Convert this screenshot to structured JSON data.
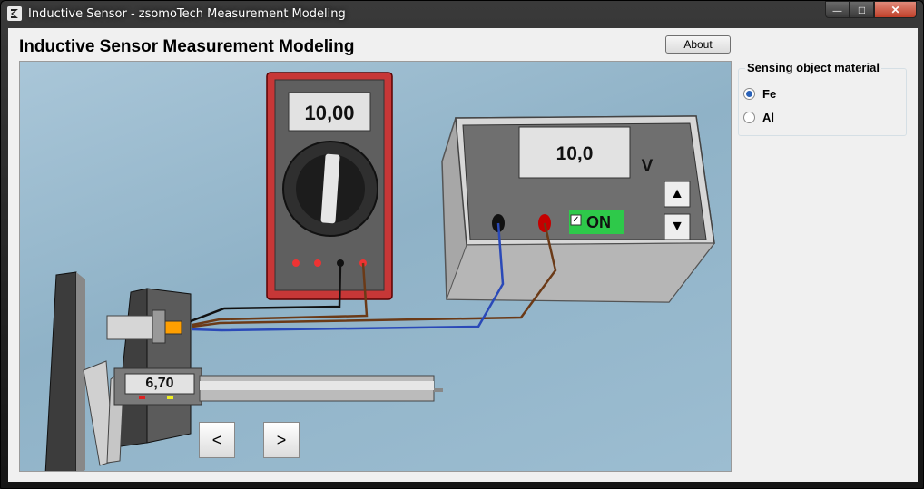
{
  "window": {
    "title": "Inductive Sensor - zsomoTech Measurement Modeling",
    "min_glyph": "—",
    "max_glyph": "□",
    "close_glyph": "✕"
  },
  "app": {
    "title": "Inductive Sensor Measurement Modeling",
    "about_label": "About"
  },
  "multimeter": {
    "reading": "10,00"
  },
  "power_supply": {
    "voltage": "10,0",
    "unit": "V",
    "on_label": "ON",
    "on_checked": true,
    "up_glyph": "▲",
    "down_glyph": "▼"
  },
  "caliper": {
    "reading": "6,70"
  },
  "nav": {
    "prev_label": "<",
    "next_label": ">"
  },
  "material": {
    "title": "Sensing object material",
    "options": [
      "Fe",
      "Al"
    ],
    "selected": "Fe"
  },
  "colors": {
    "multimeter_body": "#c73737",
    "display_bg": "#e2e2e2",
    "on_badge": "#2ec94a",
    "sensor_head": "#ff9f00",
    "canvas_bg": "#9dbbd0"
  }
}
